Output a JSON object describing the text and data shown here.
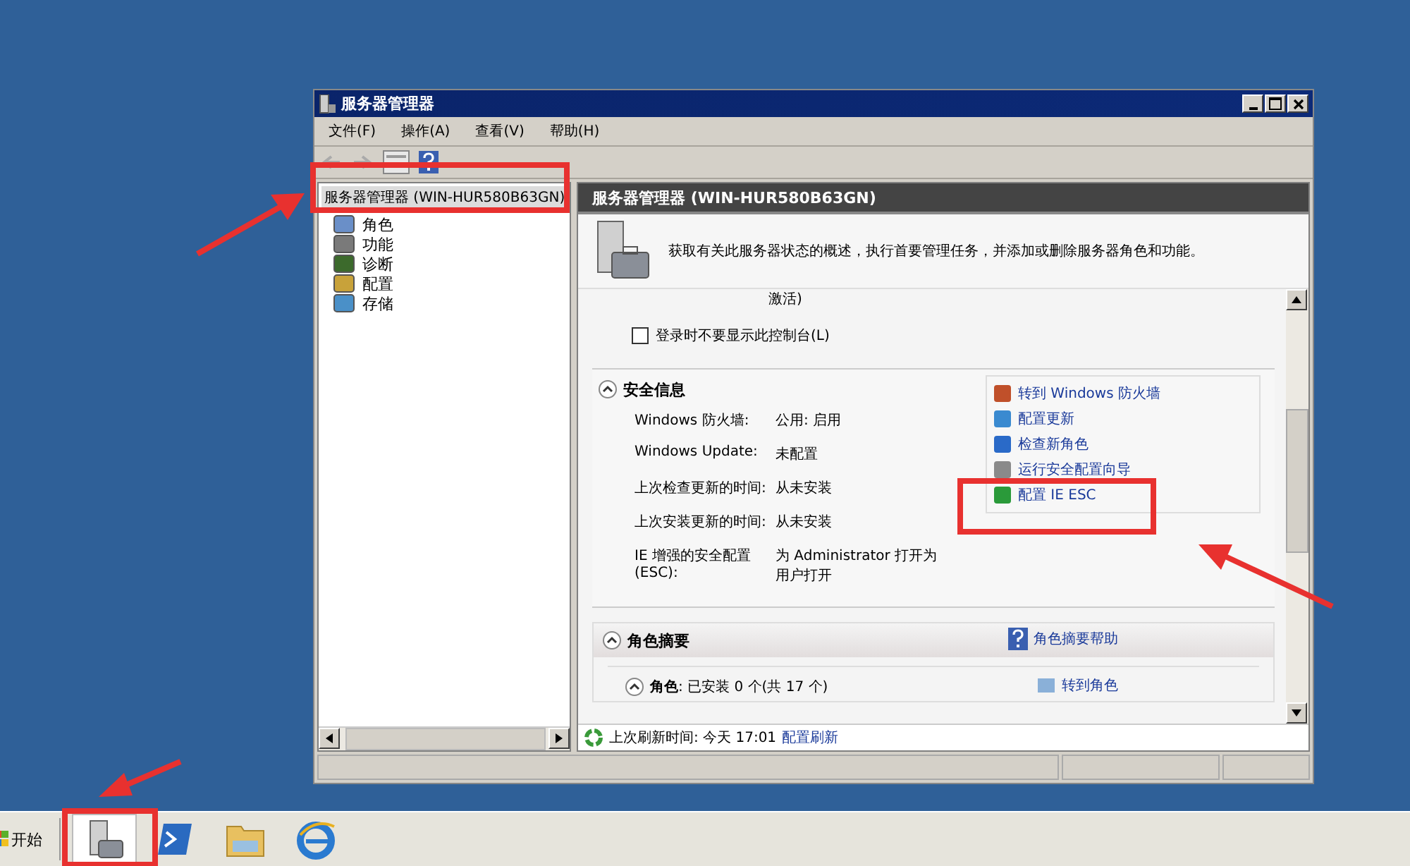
{
  "window": {
    "title": "服务器管理器"
  },
  "menu": [
    {
      "label": "文件(F)"
    },
    {
      "label": "操作(A)"
    },
    {
      "label": "查看(V)"
    },
    {
      "label": "帮助(H)"
    }
  ],
  "tree": {
    "label": "服务器管理器 (WIN-HUR580B63GN)",
    "selected": true,
    "children": [
      {
        "label": "角色",
        "kind": "roles",
        "selected": false
      },
      {
        "label": "功能",
        "kind": "features",
        "selected": false
      },
      {
        "label": "诊断",
        "kind": "diagnostics",
        "selected": false
      },
      {
        "label": "配置",
        "kind": "configuration",
        "selected": false
      },
      {
        "label": "存储",
        "kind": "storage",
        "selected": false
      }
    ]
  },
  "header": {
    "title": "服务器管理器 (WIN-HUR580B63GN)",
    "description": "获取有关此服务器状态的概述，执行首要管理任务，并添加或删除服务器角色和功能。"
  },
  "content": {
    "partial_text": "激活)",
    "checkbox": {
      "label": "登录时不要显示此控制台(L)",
      "checked": false
    },
    "security": {
      "title": "安全信息",
      "expanded": true,
      "properties": [
        {
          "label": "Windows 防火墙:",
          "value": "公用: 启用"
        },
        {
          "label": "Windows Update:",
          "value": "未配置"
        },
        {
          "label": "上次检查更新的时间:",
          "value": "从未安装"
        },
        {
          "label": "上次安装更新的时间:",
          "value": "从未安装"
        },
        {
          "label": "IE 增强的安全配置(ESC):",
          "value": "为 Administrator 打开为用户打开"
        }
      ],
      "tasks": [
        {
          "label": "转到 Windows 防火墙",
          "kind": "firewall"
        },
        {
          "label": "配置更新",
          "kind": "update"
        },
        {
          "label": "检查新角色",
          "kind": "refresh"
        },
        {
          "label": "运行安全配置向导",
          "kind": "wizard"
        },
        {
          "label": "配置 IE ESC",
          "kind": "ie-esc"
        }
      ]
    },
    "roles": {
      "title": "角色摘要",
      "expanded": true,
      "help_link": "角色摘要帮助",
      "subsection": {
        "title": "**角色**: 已安装 0 个(共 17 个)",
        "expanded": true,
        "task": "转到角色"
      }
    }
  },
  "status": {
    "text": "上次刷新时间: 今天 17:01",
    "link": "配置刷新"
  },
  "taskbar": {
    "start": "开始",
    "items": [
      {
        "kind": "server-manager",
        "selected": true
      },
      {
        "kind": "powershell",
        "selected": false
      },
      {
        "kind": "explorer",
        "selected": false
      },
      {
        "kind": "browser",
        "selected": false
      }
    ]
  }
}
